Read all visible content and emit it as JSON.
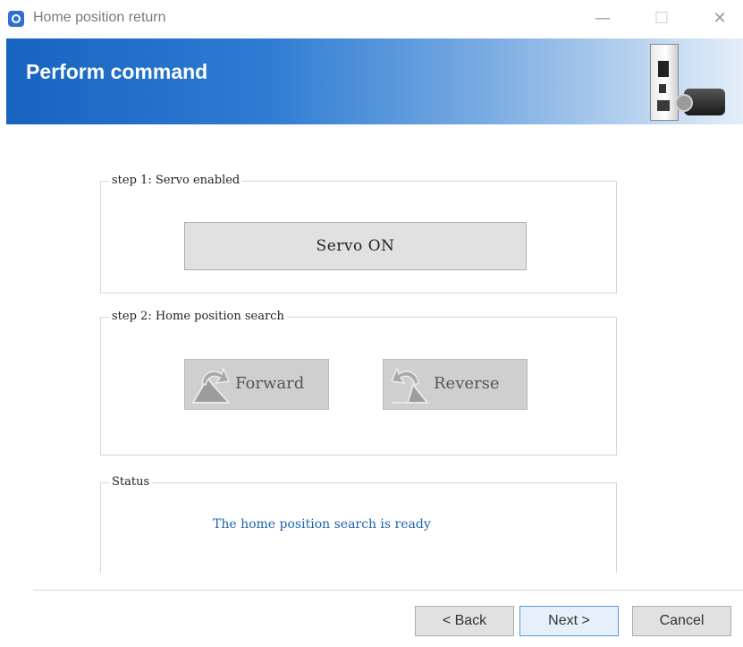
{
  "window": {
    "title": "Home position return",
    "controls": {
      "minimize": "—",
      "maximize": "☐",
      "close": "✕"
    }
  },
  "header": {
    "title": "Perform command",
    "image": "servo-drive-and-motor"
  },
  "step1": {
    "legend": "step 1: Servo enabled",
    "button_label": "Servo ON"
  },
  "step2": {
    "legend": "step 2: Home position search",
    "forward_label": "Forward",
    "reverse_label": "Reverse",
    "buttons_state": "disabled"
  },
  "status": {
    "legend": "Status",
    "message": "The home position search is ready",
    "message_color": "#1f64b0"
  },
  "footer": {
    "back_label": "< Back",
    "next_label": "Next >",
    "cancel_label": "Cancel"
  },
  "colors": {
    "header_start": "#1664c0",
    "header_end": "#e4eef9"
  }
}
